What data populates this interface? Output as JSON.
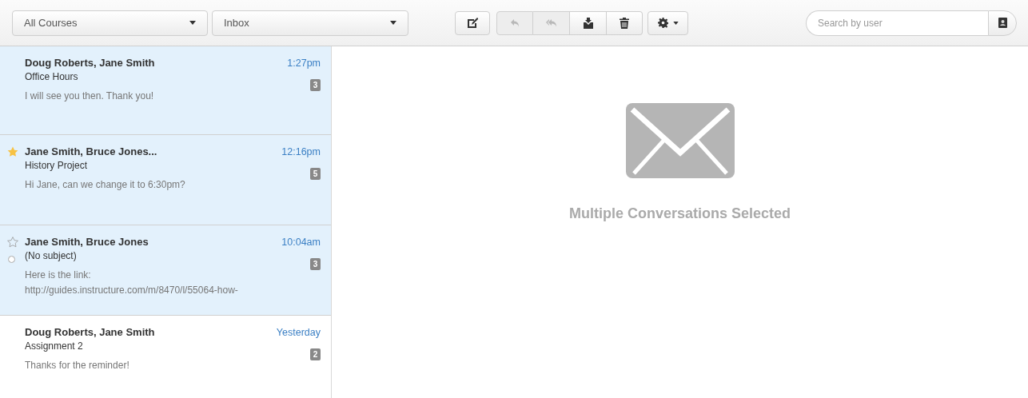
{
  "toolbar": {
    "course_filter": "All Courses",
    "mailbox_filter": "Inbox",
    "buttons": [
      {
        "kind": "compose",
        "disabled": false
      },
      {
        "kind": "reply",
        "disabled": true
      },
      {
        "kind": "reply-all",
        "disabled": true
      },
      {
        "kind": "archive",
        "disabled": false
      },
      {
        "kind": "delete",
        "disabled": false
      },
      {
        "kind": "settings",
        "disabled": false
      }
    ],
    "search": {
      "placeholder": "Search by user"
    }
  },
  "conversations": [
    {
      "participants": "Doug Roberts, Jane Smith",
      "subject": "Office Hours",
      "preview": "I will see you then. Thank you!",
      "time": "1:27pm",
      "count": "3",
      "selected": true,
      "starred": false,
      "hovered": false
    },
    {
      "participants": "Jane Smith, Bruce Jones...",
      "subject": "History Project",
      "preview": "Hi Jane, can we change it to 6:30pm?",
      "time": "12:16pm",
      "count": "5",
      "selected": true,
      "starred": true,
      "hovered": false
    },
    {
      "participants": "Jane Smith, Bruce Jones",
      "subject": "(No subject)",
      "preview": "Here is the link: http://guides.instructure.com/m/8470/l/55064-how-",
      "time": "10:04am",
      "count": "3",
      "selected": true,
      "starred": false,
      "hovered": true
    },
    {
      "participants": "Doug Roberts, Jane Smith",
      "subject": "Assignment 2",
      "preview": "Thanks for the reminder!",
      "time": "Yesterday",
      "count": "2",
      "selected": false,
      "starred": false,
      "hovered": false
    }
  ],
  "detail": {
    "message": "Multiple Conversations Selected"
  }
}
